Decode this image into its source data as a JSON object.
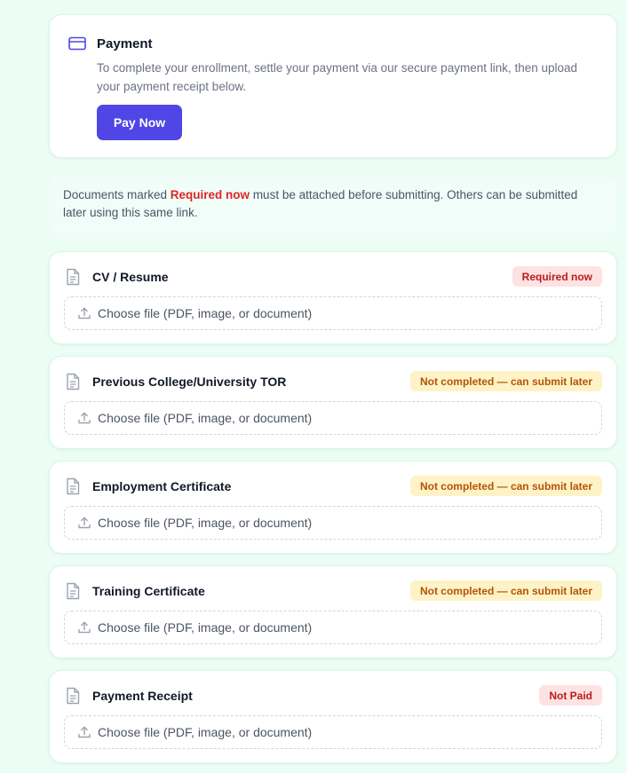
{
  "payment": {
    "icon": "credit-card-icon",
    "title": "Payment",
    "description": "To complete your enrollment, settle your payment via our secure payment link, then upload your payment receipt below.",
    "button_label": "Pay Now",
    "button_color": "#4f46e5"
  },
  "notice": {
    "prefix": "Documents marked ",
    "highlight": "Required now",
    "suffix": " must be attached before submitting. Others can be submitted later using this same link."
  },
  "documents": [
    {
      "title": "CV / Resume",
      "status": "Required now",
      "status_type": "red",
      "file_prompt": "Choose file (PDF, image, or document)"
    },
    {
      "title": "Previous College/University TOR",
      "status": "Not completed — can submit later",
      "status_type": "amber",
      "file_prompt": "Choose file (PDF, image, or document)"
    },
    {
      "title": "Employment Certificate",
      "status": "Not completed — can submit later",
      "status_type": "amber",
      "file_prompt": "Choose file (PDF, image, or document)"
    },
    {
      "title": "Training Certificate",
      "status": "Not completed — can submit later",
      "status_type": "amber",
      "file_prompt": "Choose file (PDF, image, or document)"
    },
    {
      "title": "Payment Receipt",
      "status": "Not Paid",
      "status_type": "red",
      "file_prompt": "Choose file (PDF, image, or document)"
    }
  ],
  "icons": {
    "document": "file-text-icon",
    "upload": "upload-icon"
  },
  "colors": {
    "background": "#ecfdf5",
    "required_red": "#dc2626",
    "warning_amber": "#b45309"
  }
}
